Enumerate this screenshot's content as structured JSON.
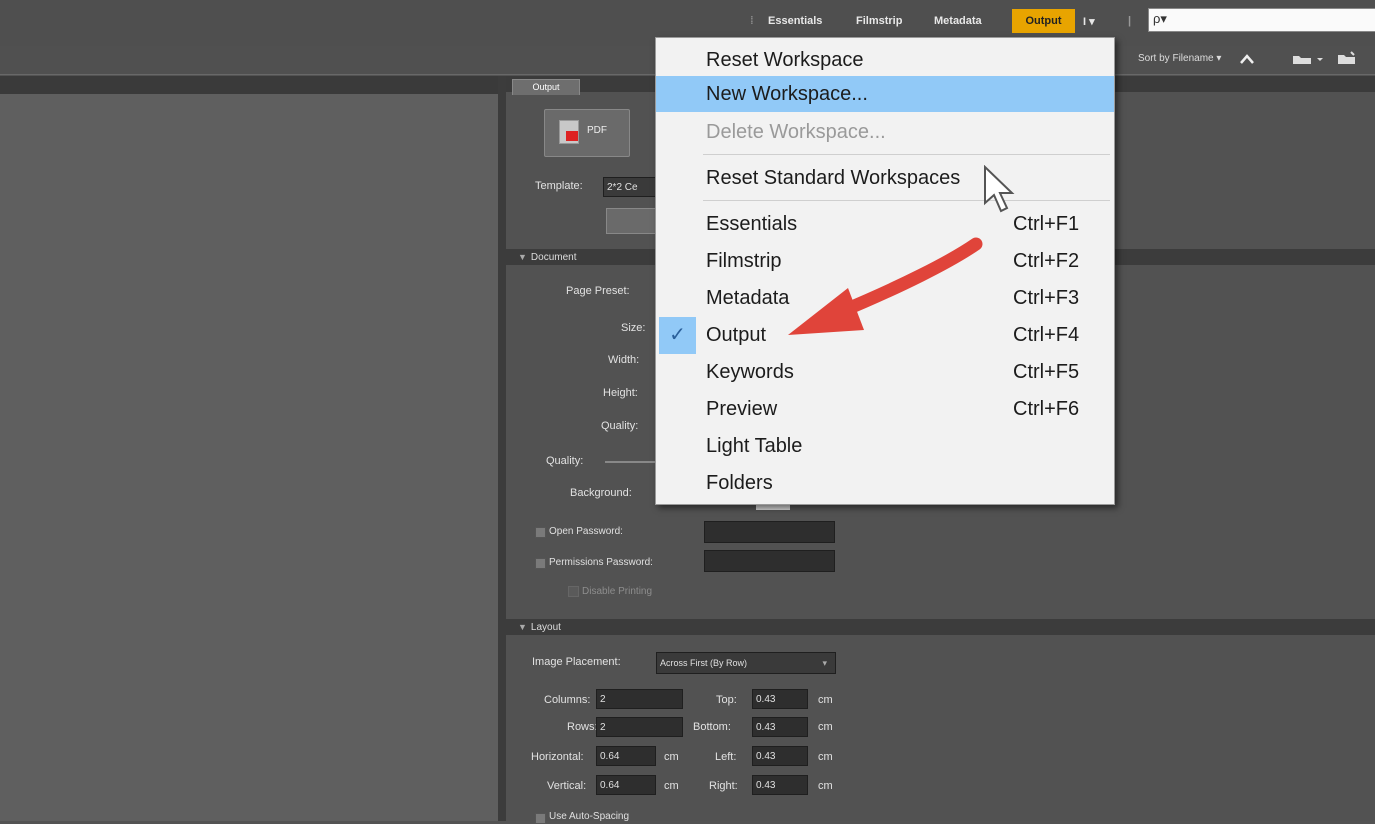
{
  "workspace_bar": {
    "essentials": "Essentials",
    "filmstrip": "Filmstrip",
    "metadata": "Metadata",
    "output": "Output",
    "more": "I ▾",
    "search_icon": "ρ▾"
  },
  "sub_toolbar": {
    "sort": "Sort by Filename ▾"
  },
  "output_panel": {
    "tab": "Output",
    "pdf_button": "PDF",
    "template_label": "Template:",
    "template_value": "2*2 Ce",
    "document_header": "Document",
    "page_preset_label": "Page Preset:",
    "size_label": "Size:",
    "width_label": "Width:",
    "height_label": "Height:",
    "quality_label": "Quality:",
    "quality2_label": "Quality:",
    "background_label": "Background:",
    "open_password_label": "Open Password:",
    "permissions_password_label": "Permissions Password:",
    "disable_printing_label": "Disable Printing",
    "layout_header": "Layout",
    "image_placement_label": "Image Placement:",
    "image_placement_value": "Across First (By Row)",
    "columns_label": "Columns:",
    "columns_value": "2",
    "rows_label": "Rows:",
    "rows_value": "2",
    "horizontal_label": "Horizontal:",
    "horizontal_value": "0.64",
    "vertical_label": "Vertical:",
    "vertical_value": "0.64",
    "top_label": "Top:",
    "top_value": "0.43",
    "bottom_label": "Bottom:",
    "bottom_value": "0.43",
    "left_label": "Left:",
    "left_value": "0.43",
    "right_label": "Right:",
    "right_value": "0.43",
    "unit": "cm",
    "auto_spacing_label": "Use Auto-Spacing"
  },
  "menu": {
    "reset_workspace": "Reset Workspace",
    "new_workspace": "New Workspace...",
    "delete_workspace": "Delete Workspace...",
    "reset_standard": "Reset Standard Workspaces",
    "items": [
      {
        "label": "Essentials",
        "shortcut": "Ctrl+F1"
      },
      {
        "label": "Filmstrip",
        "shortcut": "Ctrl+F2"
      },
      {
        "label": "Metadata",
        "shortcut": "Ctrl+F3"
      },
      {
        "label": "Output",
        "shortcut": "Ctrl+F4"
      },
      {
        "label": "Keywords",
        "shortcut": "Ctrl+F5"
      },
      {
        "label": "Preview",
        "shortcut": "Ctrl+F6"
      },
      {
        "label": "Light Table",
        "shortcut": ""
      },
      {
        "label": "Folders",
        "shortcut": ""
      }
    ],
    "check": "✓"
  },
  "colors": {
    "active_workspace": "#e8a400",
    "menu_highlight": "#91c9f7",
    "annotation_arrow": "#e0443a"
  }
}
